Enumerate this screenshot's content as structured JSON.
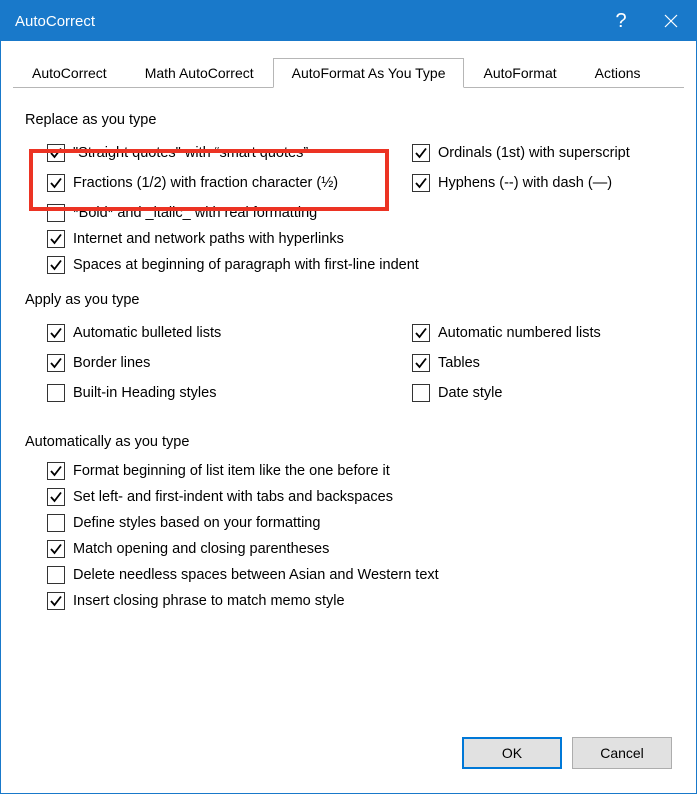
{
  "window": {
    "title": "AutoCorrect"
  },
  "tabs": {
    "t0": "AutoCorrect",
    "t1": "Math AutoCorrect",
    "t2": "AutoFormat As You Type",
    "t3": "AutoFormat",
    "t4": "Actions"
  },
  "sections": {
    "replace": "Replace as you type",
    "apply": "Apply as you type",
    "auto": "Automatically as you type"
  },
  "replace": {
    "quotes": "\"Straight quotes\" with “smart quotes”",
    "ordinals": "Ordinals (1st) with superscript",
    "fractions": "Fractions (1/2) with fraction character (½)",
    "hyphens": "Hyphens (--) with dash (—)",
    "bold": "*Bold* and _italic_ with real formatting",
    "internet": "Internet and network paths with hyperlinks",
    "spaces": "Spaces at beginning of paragraph with first-line indent"
  },
  "apply": {
    "bulleted": "Automatic bulleted lists",
    "numbered": "Automatic numbered lists",
    "border": "Border lines",
    "tables": "Tables",
    "heading": "Built-in Heading styles",
    "date": "Date style"
  },
  "auto": {
    "format_item": "Format beginning of list item like the one before it",
    "indent": "Set left- and first-indent with tabs and backspaces",
    "styles": "Define styles based on your formatting",
    "paren": "Match opening and closing parentheses",
    "spaces_asian": "Delete needless spaces between Asian and Western text",
    "memo": "Insert closing phrase to match memo style"
  },
  "buttons": {
    "ok": "OK",
    "cancel": "Cancel"
  }
}
